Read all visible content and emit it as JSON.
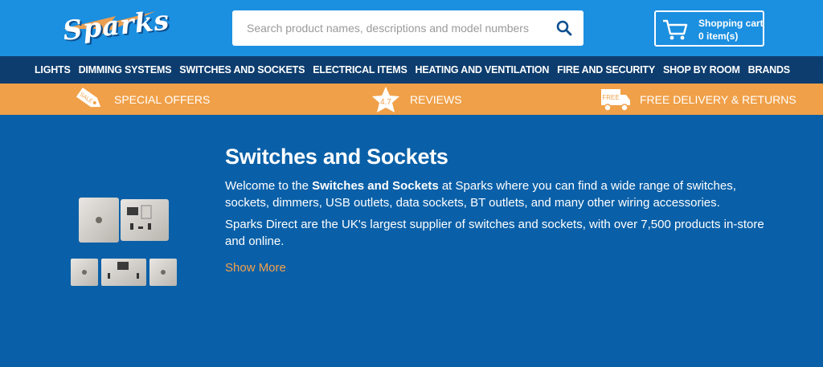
{
  "header": {
    "logo_text": "Sparks",
    "search": {
      "placeholder": "Search product names, descriptions and model numbers"
    },
    "cart": {
      "title": "Shopping cart",
      "count": "0 item(s)"
    }
  },
  "nav": {
    "items": [
      {
        "label": "LIGHTS"
      },
      {
        "label": "DIMMING SYSTEMS"
      },
      {
        "label": "SWITCHES AND SOCKETS"
      },
      {
        "label": "ELECTRICAL ITEMS"
      },
      {
        "label": "HEATING AND VENTILATION"
      },
      {
        "label": "FIRE AND SECURITY"
      },
      {
        "label": "SHOP BY ROOM"
      },
      {
        "label": "BRANDS"
      }
    ]
  },
  "promo": {
    "special_offers": {
      "label": "SPECIAL OFFERS",
      "badge": "SALE"
    },
    "reviews": {
      "label": "REVIEWS",
      "badge": "4.7"
    },
    "delivery": {
      "label": "FREE DELIVERY & RETURNS",
      "badge": "FREE"
    }
  },
  "main": {
    "title": "Switches and Sockets",
    "intro_prefix": "Welcome to the ",
    "intro_bold": "Switches and Sockets",
    "intro_suffix": " at Sparks where you can find a wide range of switches, sockets, dimmers, USB outlets, data sockets, BT outlets, and many other wiring accessories.",
    "para2": "Sparks Direct are the UK's largest supplier of switches and sockets, with over 7,500 products in-store and online.",
    "show_more": "Show More"
  },
  "colors": {
    "topbar": "#1b8fe0",
    "nav": "#0d3d6e",
    "promo": "#f0a048",
    "body": "#0a60a8",
    "accent": "#f5a04a"
  }
}
